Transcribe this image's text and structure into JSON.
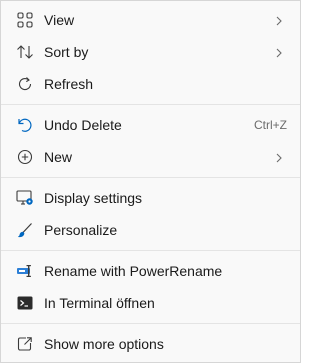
{
  "menu": {
    "items": [
      {
        "label": "View",
        "icon": "grid-view-icon",
        "submenu": true
      },
      {
        "label": "Sort by",
        "icon": "sort-arrows-icon",
        "submenu": true
      },
      {
        "label": "Refresh",
        "icon": "refresh-icon",
        "submenu": false
      },
      {
        "label": "Undo Delete",
        "icon": "undo-icon",
        "shortcut": "Ctrl+Z",
        "submenu": false
      },
      {
        "label": "New",
        "icon": "add-circle-icon",
        "submenu": true
      },
      {
        "label": "Display settings",
        "icon": "display-settings-icon",
        "submenu": false
      },
      {
        "label": "Personalize",
        "icon": "brush-icon",
        "submenu": false
      },
      {
        "label": "Rename with PowerRename",
        "icon": "powerrename-icon",
        "submenu": false
      },
      {
        "label": "In Terminal öffnen",
        "icon": "terminal-icon",
        "submenu": false
      },
      {
        "label": "Show more options",
        "icon": "share-open-icon",
        "submenu": false
      }
    ]
  },
  "colors": {
    "accent": "#0067c0",
    "icon": "#3a3a3a",
    "text": "#1a1a1a",
    "shortcut": "#6b6b6b",
    "separator": "#e4e4e4"
  }
}
